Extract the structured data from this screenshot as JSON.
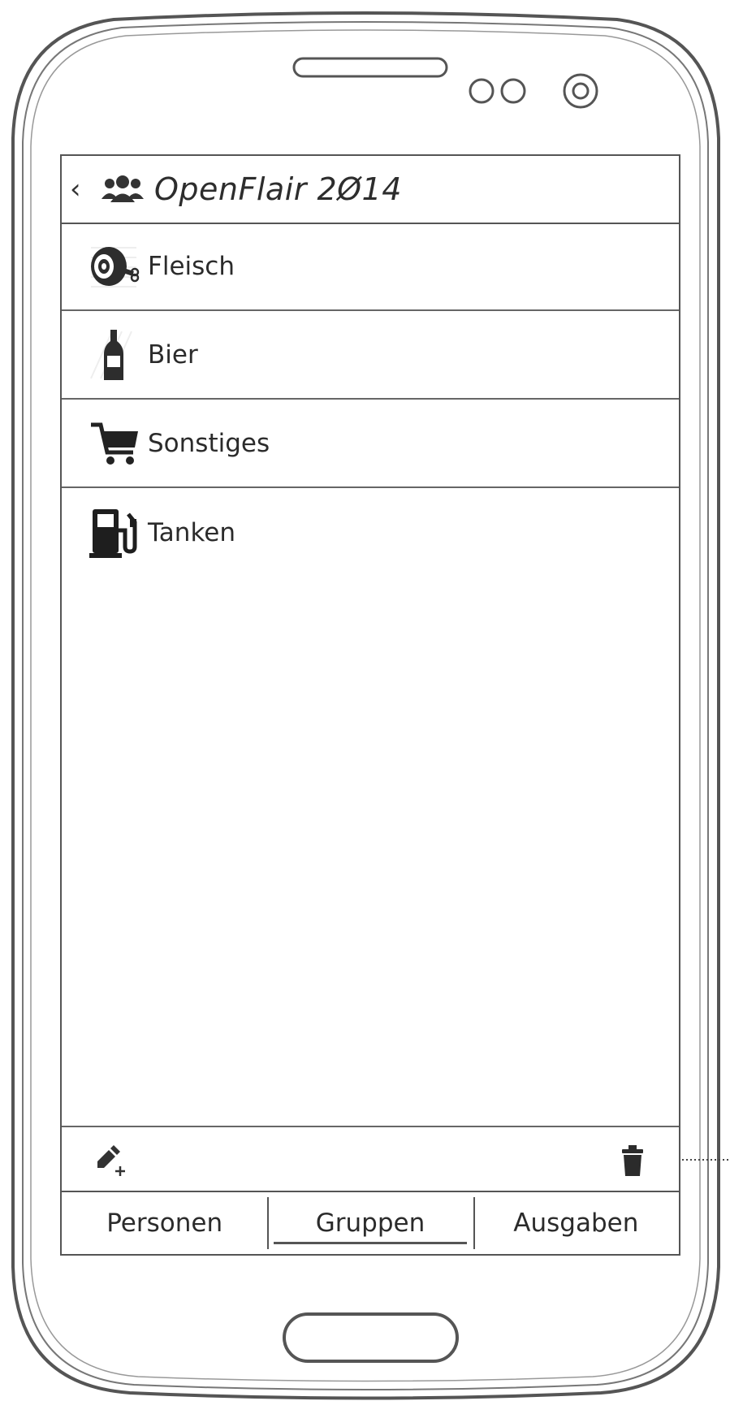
{
  "header": {
    "back_icon": "chevron-left-icon",
    "group_icon": "group-icon",
    "title": "OpenFlair 2Ø14"
  },
  "groups": [
    {
      "label": "Fleisch",
      "icon": "meat-icon"
    },
    {
      "label": "Bier",
      "icon": "beer-bottle-icon"
    },
    {
      "label": "Sonstiges",
      "icon": "shopping-cart-icon"
    },
    {
      "label": "Tanken",
      "icon": "fuel-pump-icon"
    }
  ],
  "actions": {
    "add_icon": "add-edit-icon",
    "delete_icon": "trash-icon"
  },
  "tabs": [
    {
      "label": "Personen",
      "active": false
    },
    {
      "label": "Gruppen",
      "active": true
    },
    {
      "label": "Ausgaben",
      "active": false
    }
  ]
}
